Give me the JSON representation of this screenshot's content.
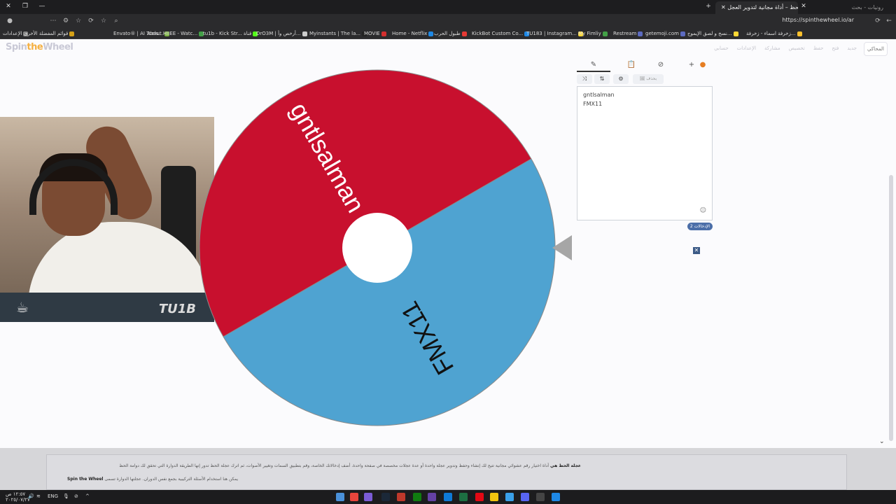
{
  "browser": {
    "active_tab_title": "عجلة الحظ – أداة مجانية لتدوير العجل",
    "inactive_tab_title": "رونيات - بحث",
    "url": "https://spinthewheel.io/ar",
    "new_tab_icon": "plus-icon"
  },
  "bookmarks": [
    {
      "label": "الإعدادات",
      "color": "#888888"
    },
    {
      "label": "قوائم المفضلة الأخرى",
      "color": "#d4a017"
    },
    {
      "label": "Envato® | AI Tools...",
      "color": "#7cb342"
    },
    {
      "label": "About HIIEE - Watc...",
      "color": "#43a047"
    },
    {
      "label": "tu1b - Kick Str... قناة",
      "color": "#53fc18"
    },
    {
      "label": "DrO3M | أرخص وأ...",
      "color": "#cccccc"
    },
    {
      "label": "Myinstants | The la...",
      "color": "#222222"
    },
    {
      "label": "MOVIE",
      "color": "#d32f2f"
    },
    {
      "label": "Home - Netflix",
      "color": "#1e88e5"
    },
    {
      "label": "طبول الحرب",
      "color": "#e53935"
    },
    {
      "label": "KickBot Custom Co...",
      "color": "#1e88e5"
    },
    {
      "label": "TU183 | Instagram...",
      "color": "#fdd835"
    },
    {
      "label": "My Fimliy",
      "color": "#43a047"
    },
    {
      "label": "Restream",
      "color": "#5c6bc0"
    },
    {
      "label": "getemoji.com",
      "color": "#5c6bc0"
    },
    {
      "label": "نسخ و لصق الإيموج...",
      "color": "#fdd835"
    },
    {
      "label": "زخرفة اسماء - زخرفة...",
      "color": "#fbc02d"
    }
  ],
  "site": {
    "logo_main": "Spin",
    "logo_accent": "the",
    "logo_end": "Wheel",
    "nav_items": [
      "حسابي",
      "الإعدادات",
      "مشاركة",
      "تخصيص",
      "حفظ",
      "فتح",
      "جديد"
    ],
    "side_button": "المحاكي"
  },
  "wheel": {
    "segments": [
      {
        "label": "gntlsalman",
        "color": "#c8102e"
      },
      {
        "label": "FMX11",
        "color": "#4fa3d1"
      }
    ],
    "pointer_color": "#a6a6a6"
  },
  "panel": {
    "tabs": [
      {
        "name": "edit",
        "icon": "pencil-icon",
        "glyph": "✎"
      },
      {
        "name": "results",
        "icon": "clipboard-icon",
        "glyph": "📋"
      },
      {
        "name": "hidden",
        "icon": "eye-off-icon",
        "glyph": "⊘"
      },
      {
        "name": "add",
        "icon": "plus-icon",
        "glyph": "+"
      },
      {
        "name": "colors",
        "icon": "color-wheel-icon",
        "glyph": "●"
      }
    ],
    "toolbar": [
      {
        "name": "shuffle",
        "glyph": "⤨"
      },
      {
        "name": "sort",
        "glyph": "⇅"
      },
      {
        "name": "settings",
        "glyph": "⚙"
      },
      {
        "name": "image",
        "glyph": "🖼 بحذف"
      }
    ],
    "entries": [
      "gntlsalman",
      "FMX11"
    ],
    "entries_count": "الإدخالات 2"
  },
  "footer": {
    "line1_bold": "عجلة الحظ هي",
    "line1_rest": "أداة اختيار رقم عشوائي مجانية تتيح لك إنشاء وحفظ وتدوير عجلة واحدة أو عدة عجلات مخصصة في صفحة واحدة. أضف إدخالاتك الخاصة، وقم بتطبيق السمات وتغيير الأصوات، ثم اترك عجلة الحظ تدور إنها الطريقة الدوارة التي تحقق لك دوامة الحظ",
    "line2_bold": "Spin the Wheel",
    "line2_rest": "يمكن هنا استخدام الأسئلة التركيبية بجمع نفس الدوران. عجلتها الدوارة تسمى"
  },
  "taskbar": {
    "time": "١٢:٥٧ ص",
    "date": "٢٠٢٥/٠٧/٢٧",
    "lang": "ENG"
  }
}
